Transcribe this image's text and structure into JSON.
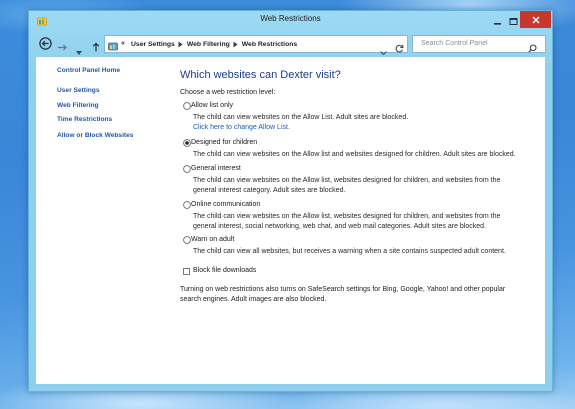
{
  "window": {
    "title": "Web Restrictions",
    "icon": "control-panel-icon",
    "controls": [
      "minimize-icon",
      "maximize-icon",
      "close-icon"
    ]
  },
  "address_bar": {
    "nav_icons": [
      "back-arrow-icon",
      "forward-arrow-icon",
      "recent-locations-icon",
      "up-arrow-icon"
    ],
    "location_icon": "control-panel-icon",
    "overflow": "«",
    "breadcrumb": [
      "User Settings",
      "Web Filtering",
      "Web Restrictions"
    ],
    "right_icons": [
      "dropdown-icon",
      "refresh-icon"
    ]
  },
  "search": {
    "placeholder": "Search Control Panel",
    "icon": "search-icon"
  },
  "sidebar": {
    "links": [
      "Control Panel Home",
      "User Settings",
      "Web Filtering",
      "Time Restrictions",
      "Allow or Block Websites"
    ]
  },
  "main": {
    "heading": "Which websites can Dexter visit?",
    "prompt": "Choose a web restriction level:",
    "options": [
      {
        "label": "Allow list only",
        "selected": false,
        "desc": [
          "The child can view websites on the Allow List. Adult sites are blocked."
        ],
        "link": "Click here to change Allow List."
      },
      {
        "label": "Designed for children",
        "selected": true,
        "desc": [
          "The child can view websites on the Allow list and websites designed for children. Adult sites are blocked."
        ]
      },
      {
        "label": "General interest",
        "selected": false,
        "desc": [
          "The child can view websites on the Allow list, websites designed for children, and websites from the",
          "general interest category. Adult sites are blocked."
        ]
      },
      {
        "label": "Online communication",
        "selected": false,
        "desc": [
          "The child can view websites on the Allow list, websites designed for children, and websites from the",
          "general interest, social networking, web chat, and web mail categories. Adult sites are blocked."
        ]
      },
      {
        "label": "Warn on adult",
        "selected": false,
        "desc": [
          "The child can view all websites, but receives a warning when a site contains suspected adult content."
        ]
      }
    ],
    "block_downloads": {
      "label": "Block file downloads",
      "checked": false
    },
    "note": [
      "Turning on web restrictions also turns on SafeSearch settings for Bing, Google, Yahoo! and other popular",
      "search engines. Adult images are also blocked."
    ]
  },
  "colors": {
    "desktop": "#3d8cdc",
    "frame": "#8fd0ee",
    "close_button": "#c7372e",
    "heading": "#1e3a8a",
    "sidebar_link": "#2157a8",
    "link": "#1d5db3"
  }
}
